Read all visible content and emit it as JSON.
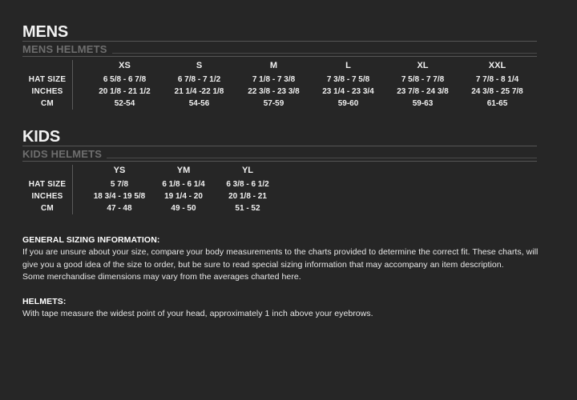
{
  "page": {
    "background_color": "#262626",
    "text_color": "#f0f0f0",
    "muted_color": "#6e6e6e",
    "rule_color": "#565656"
  },
  "sections": [
    {
      "id": "mens",
      "title": "MENS",
      "subtitle": "MENS HELMETS",
      "row_labels": [
        "HAT SIZE",
        "INCHES",
        "CM"
      ],
      "columns": [
        {
          "size": "XS",
          "hat_size": "6 5/8 - 6 7/8",
          "inches": "20 1/8 - 21 1/2",
          "cm": "52-54"
        },
        {
          "size": "S",
          "hat_size": "6 7/8 - 7 1/2",
          "inches": "21 1/4 -22 1/8",
          "cm": "54-56"
        },
        {
          "size": "M",
          "hat_size": "7 1/8 - 7 3/8",
          "inches": "22 3/8 - 23 3/8",
          "cm": "57-59"
        },
        {
          "size": "L",
          "hat_size": "7 3/8 - 7 5/8",
          "inches": "23 1/4 - 23 3/4",
          "cm": "59-60"
        },
        {
          "size": "XL",
          "hat_size": "7 5/8 - 7 7/8",
          "inches": "23 7/8 - 24 3/8",
          "cm": "59-63"
        },
        {
          "size": "XXL",
          "hat_size": "7 7/8 - 8 1/4",
          "inches": "24 3/8 - 25 7/8",
          "cm": "61-65"
        }
      ]
    },
    {
      "id": "kids",
      "title": "KIDS",
      "subtitle": "KIDS HELMETS",
      "row_labels": [
        "HAT SIZE",
        "INCHES",
        "CM"
      ],
      "columns": [
        {
          "size": "YS",
          "hat_size": "5 7/8",
          "inches": "18 3/4 - 19 5/8",
          "cm": "47 - 48"
        },
        {
          "size": "YM",
          "hat_size": "6 1/8 - 6 1/4",
          "inches": "19 1/4 - 20",
          "cm": "49 - 50"
        },
        {
          "size": "YL",
          "hat_size": "6 3/8 - 6 1/2",
          "inches": "20 1/8 - 21",
          "cm": "51 - 52"
        }
      ]
    }
  ],
  "info": {
    "general": {
      "heading": "GENERAL SIZING INFORMATION:",
      "lines": [
        "If you are unsure about your size, compare your body measurements to the charts provided to determine the correct fit. These charts, will",
        "give you a good idea of the size to order, but be sure to read special sizing information that may accompany an item description.",
        "Some merchandise dimensions may vary from the averages charted here."
      ]
    },
    "helmets": {
      "heading": "HELMETS:",
      "lines": [
        "With tape measure the widest point of your head, approximately 1 inch above your eyebrows."
      ]
    }
  }
}
